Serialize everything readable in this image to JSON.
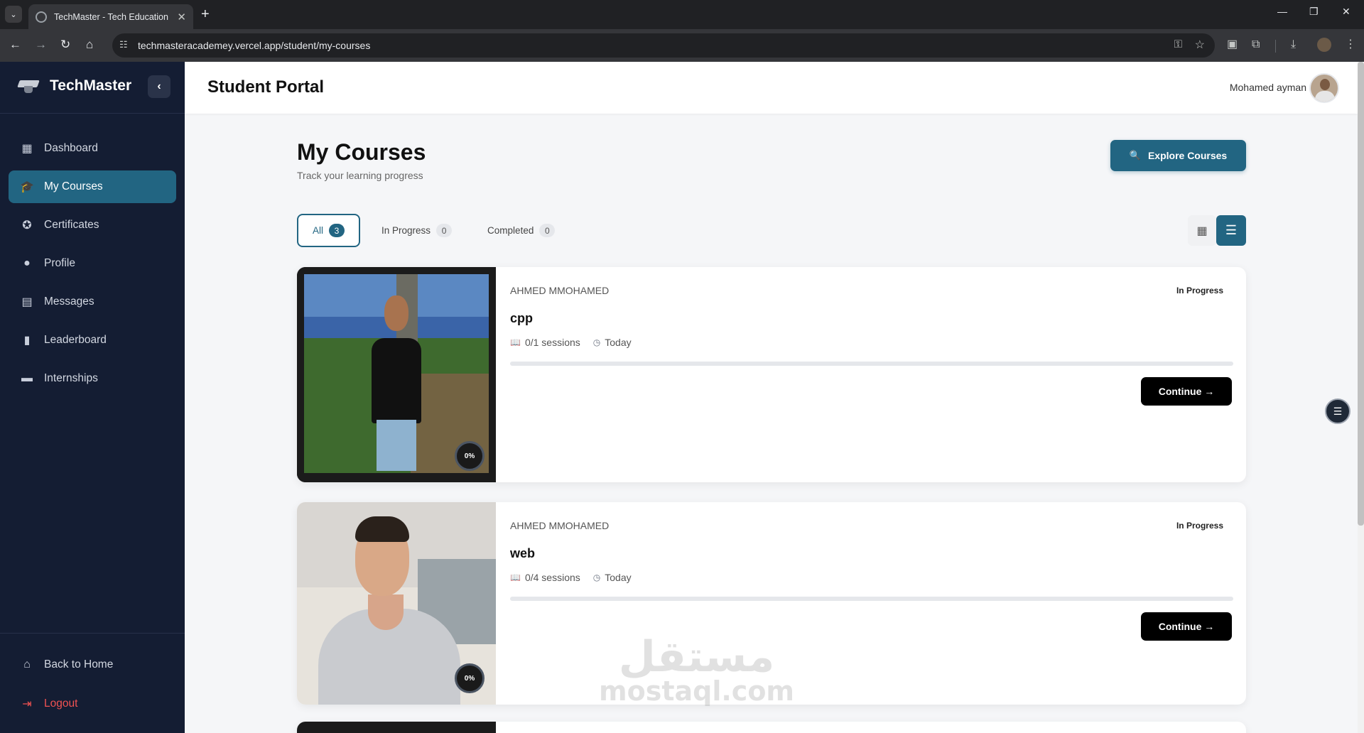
{
  "browser": {
    "tab_title": "TechMaster - Tech Education Pl",
    "url": "techmasteracademey.vercel.app/student/my-courses",
    "new_tab": "+",
    "close_tab": "✕"
  },
  "sidebar": {
    "brand": "TechMaster",
    "items": [
      {
        "label": "Dashboard",
        "icon": "dashboard-icon",
        "glyph": "▦"
      },
      {
        "label": "My Courses",
        "icon": "graduation-cap-icon",
        "glyph": "🎓"
      },
      {
        "label": "Certificates",
        "icon": "certificate-icon",
        "glyph": "🎖"
      },
      {
        "label": "Profile",
        "icon": "user-icon",
        "glyph": "👤"
      },
      {
        "label": "Messages",
        "icon": "message-icon",
        "glyph": "💬"
      },
      {
        "label": "Leaderboard",
        "icon": "bar-chart-icon",
        "glyph": "📊"
      },
      {
        "label": "Internships",
        "icon": "briefcase-icon",
        "glyph": "💼"
      }
    ],
    "active_index": 1,
    "back_home": "Back to Home",
    "logout": "Logout"
  },
  "header": {
    "title": "Student Portal",
    "user_name": "Mohamed ayman"
  },
  "main": {
    "title": "My Courses",
    "subtitle": "Track your learning progress",
    "explore_label": "Explore Courses",
    "filters": [
      {
        "label": "All",
        "count": "3"
      },
      {
        "label": "In Progress",
        "count": "0"
      },
      {
        "label": "Completed",
        "count": "0"
      }
    ],
    "active_filter": 0,
    "view_mode": "list"
  },
  "courses": [
    {
      "instructor": "AHMED MMOHAMED",
      "status": "In Progress",
      "title": "cpp",
      "sessions": "0/1 sessions",
      "date": "Today",
      "progress_label": "0%",
      "progress": 0,
      "continue_label": "Continue →"
    },
    {
      "instructor": "AHMED MMOHAMED",
      "status": "In Progress",
      "title": "web",
      "sessions": "0/4 sessions",
      "date": "Today",
      "progress_label": "0%",
      "progress": 0,
      "continue_label": "Continue →"
    }
  ],
  "watermark": {
    "arabic": "مستقل",
    "latin": "mostaql.com"
  },
  "colors": {
    "sidebar_bg": "#141d33",
    "accent": "#226582",
    "logout": "#f05252"
  }
}
